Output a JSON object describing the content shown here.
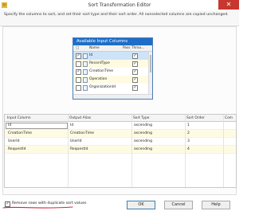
{
  "window": {
    "title": "Sort Transformation Editor",
    "close_glyph": "✕"
  },
  "description": "Specify the columns to sort, and set their sort type and their sort order. All nonselected columns are copied unchanged.",
  "available_columns": {
    "title": "Available Input Columns",
    "headers": {
      "name": "Name",
      "pass_through": "Pass Throu..."
    },
    "rows": [
      {
        "name": "Id",
        "selected": true,
        "pass_through": true
      },
      {
        "name": "RecordType",
        "selected": false,
        "pass_through": true
      },
      {
        "name": "CreationTime",
        "selected": true,
        "pass_through": true
      },
      {
        "name": "Operation",
        "selected": false,
        "pass_through": true
      },
      {
        "name": "OrganizationId",
        "selected": false,
        "pass_through": true
      }
    ]
  },
  "grid": {
    "headers": [
      "Input Column",
      "Output Alias",
      "Sort Type",
      "Sort Order",
      "Com"
    ],
    "rows": [
      {
        "input": "Id",
        "alias": "Id",
        "type": "ascending",
        "order": "1"
      },
      {
        "input": "CreationTime",
        "alias": "CreationTime",
        "type": "ascending",
        "order": "2"
      },
      {
        "input": "UserId",
        "alias": "UserId",
        "type": "ascending",
        "order": "3"
      },
      {
        "input": "RequestId",
        "alias": "RequestId",
        "type": "ascending",
        "order": "4"
      }
    ]
  },
  "footer": {
    "remove_duplicates_label": "Remove rows with duplicate sort values",
    "remove_duplicates_checked": true,
    "ok": "OK",
    "cancel": "Cancel",
    "help": "Help"
  },
  "colors": {
    "title_bar_accent": "#1e6ec8",
    "close_button": "#c7372f",
    "alt_row": "#fffbe3",
    "selected_row": "#cde3f7",
    "annotation_underline": "#d6263a"
  }
}
